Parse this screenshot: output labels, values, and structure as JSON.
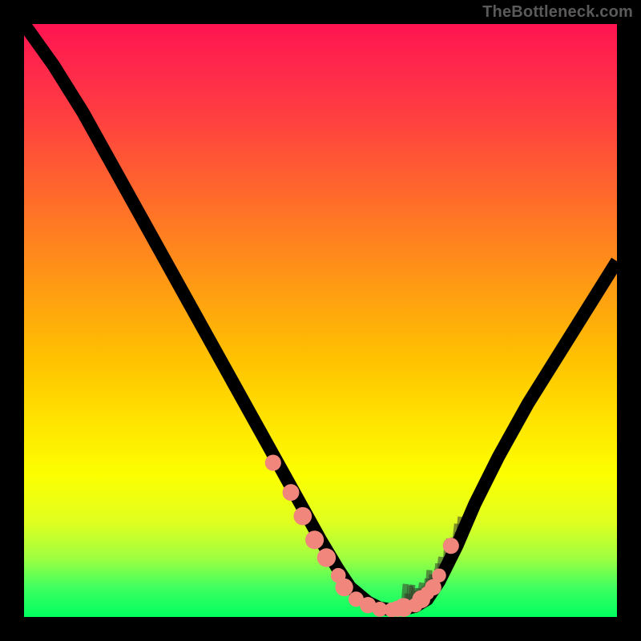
{
  "watermark": "TheBottleneck.com",
  "chart_data": {
    "type": "line",
    "title": "",
    "xlabel": "",
    "ylabel": "",
    "xlim": [
      0,
      100
    ],
    "ylim": [
      0,
      100
    ],
    "curve": {
      "name": "bottleneck-curve",
      "x": [
        0,
        5,
        10,
        15,
        20,
        25,
        30,
        35,
        40,
        45,
        50,
        53,
        55,
        58,
        60,
        62,
        64,
        66,
        68,
        70,
        73,
        76,
        80,
        85,
        90,
        95,
        100
      ],
      "y": [
        100,
        93,
        85,
        76,
        67,
        58,
        49,
        40,
        31,
        22,
        13,
        8,
        5,
        2.5,
        1.5,
        1.2,
        1.3,
        1.8,
        3,
        6,
        12,
        19,
        27,
        36,
        44,
        52,
        60
      ]
    },
    "markers": {
      "name": "optimal-dots",
      "x": [
        42,
        45,
        47,
        49,
        51,
        53,
        54,
        56,
        58,
        60,
        62,
        63,
        64,
        66,
        67,
        68,
        69,
        70,
        72
      ],
      "y": [
        26,
        21,
        17,
        13,
        10,
        7,
        5,
        3,
        2,
        1.3,
        1.2,
        1.4,
        1.6,
        2,
        3,
        4,
        5,
        7,
        12
      ]
    },
    "hash_marks": {
      "name": "right-branch-ticks",
      "x_start": 64,
      "x_end": 74,
      "count": 28
    },
    "colors": {
      "gradient_top": "#ff1450",
      "gradient_mid": "#ffe000",
      "gradient_bottom": "#00ff60",
      "curve": "#000000",
      "dots": "#f0867c"
    }
  }
}
